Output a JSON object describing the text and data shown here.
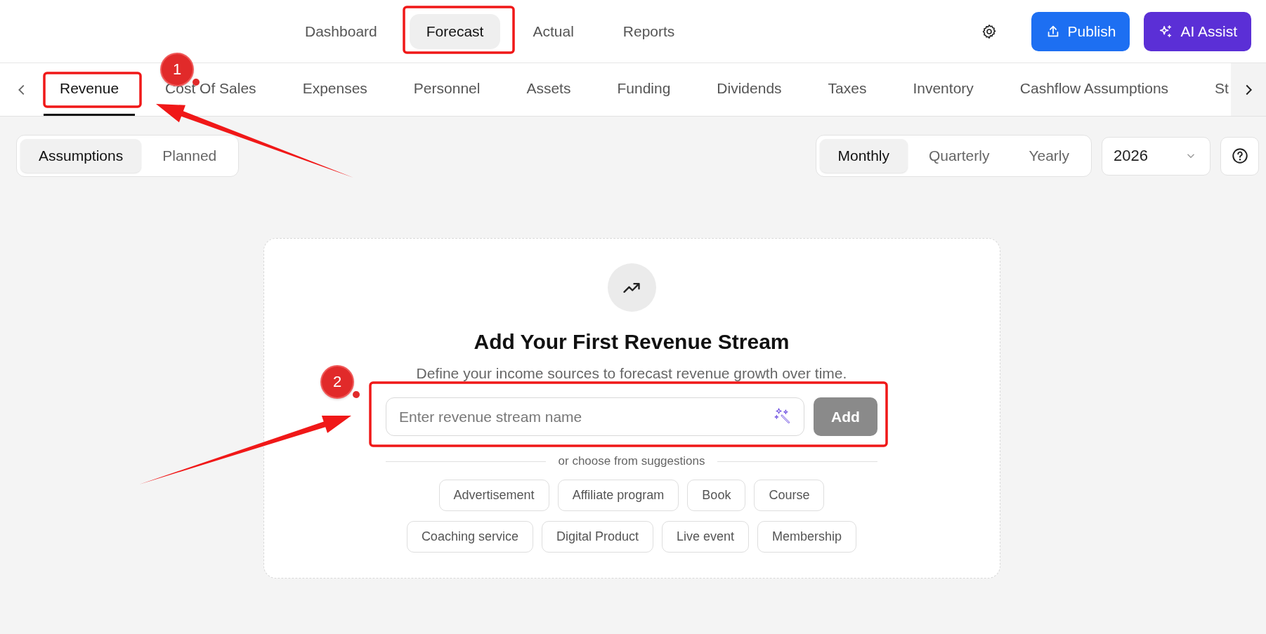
{
  "nav": [
    {
      "label": "Dashboard",
      "selected": false
    },
    {
      "label": "Forecast",
      "selected": true
    },
    {
      "label": "Actual",
      "selected": false
    },
    {
      "label": "Reports",
      "selected": false
    }
  ],
  "actions": [
    {
      "kind": "primary",
      "label": "Publish"
    },
    {
      "kind": "ai",
      "label": "AI Assist"
    }
  ],
  "tabs": [
    {
      "label": "Revenue",
      "selected": true
    },
    {
      "label": "Cost Of Sales",
      "selected": false
    },
    {
      "label": "Expenses",
      "selected": false
    },
    {
      "label": "Personnel",
      "selected": false
    },
    {
      "label": "Assets",
      "selected": false
    },
    {
      "label": "Funding",
      "selected": false
    },
    {
      "label": "Dividends",
      "selected": false
    },
    {
      "label": "Taxes",
      "selected": false
    },
    {
      "label": "Inventory",
      "selected": false
    },
    {
      "label": "Cashflow Assumptions",
      "selected": false
    },
    {
      "label": "St",
      "selected": false
    }
  ],
  "view_toggle": [
    {
      "label": "Assumptions",
      "selected": true
    },
    {
      "label": "Planned",
      "selected": false
    }
  ],
  "period_toggle": [
    {
      "label": "Monthly",
      "selected": true
    },
    {
      "label": "Quarterly",
      "selected": false
    },
    {
      "label": "Yearly",
      "selected": false
    }
  ],
  "year_select": {
    "value": "2026"
  },
  "empty_state": {
    "title": "Add Your First Revenue Stream",
    "subtitle": "Define your income sources to forecast revenue growth over time.",
    "input": {
      "placeholder": "Enter revenue stream name"
    },
    "add_button": {
      "label": "Add",
      "disabled": true
    },
    "divider": "or choose from suggestions",
    "suggestions": [
      [
        "Advertisement",
        "Affiliate program",
        "Book",
        "Course"
      ],
      [
        "Coaching service",
        "Digital Product",
        "Live event",
        "Membership"
      ]
    ]
  },
  "callouts": [
    {
      "label": "1"
    },
    {
      "label": "2"
    }
  ]
}
